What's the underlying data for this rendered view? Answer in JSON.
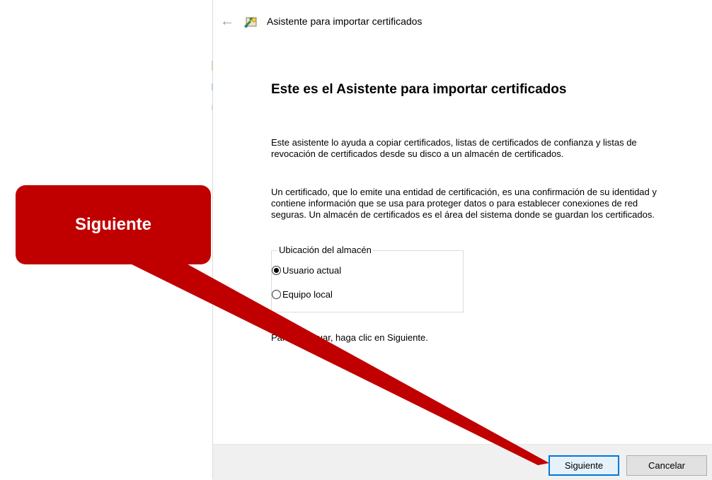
{
  "window": {
    "title": "Asistente para importar certificados",
    "back_icon": "back-arrow-icon",
    "app_icon": "certificate-wizard-icon"
  },
  "content": {
    "heading": "Este es el Asistente para importar certificados",
    "paragraph1": "Este asistente lo ayuda a copiar certificados, listas de certificados de confianza y listas de revocación de certificados desde su disco a un almacén de certificados.",
    "paragraph2": "Un certificado, que lo emite una entidad de certificación, es una confirmación de su identidad y contiene información que se usa para proteger datos o para establecer conexiones de red seguras. Un almacén de certificados es el área del sistema donde se guardan los certificados.",
    "store_location": {
      "legend": "Ubicación del almacén",
      "options": [
        {
          "label": "Usuario actual",
          "selected": true
        },
        {
          "label": "Equipo local",
          "selected": false
        }
      ]
    },
    "continue_text": "Para continuar, haga clic en Siguiente."
  },
  "footer": {
    "next_label": "Siguiente",
    "cancel_label": "Cancelar"
  },
  "annotation": {
    "callout_text": "Siguiente",
    "color": "#c00000"
  },
  "colors": {
    "focus_border": "#0078d7",
    "footer_bg": "#f0f0f0"
  }
}
